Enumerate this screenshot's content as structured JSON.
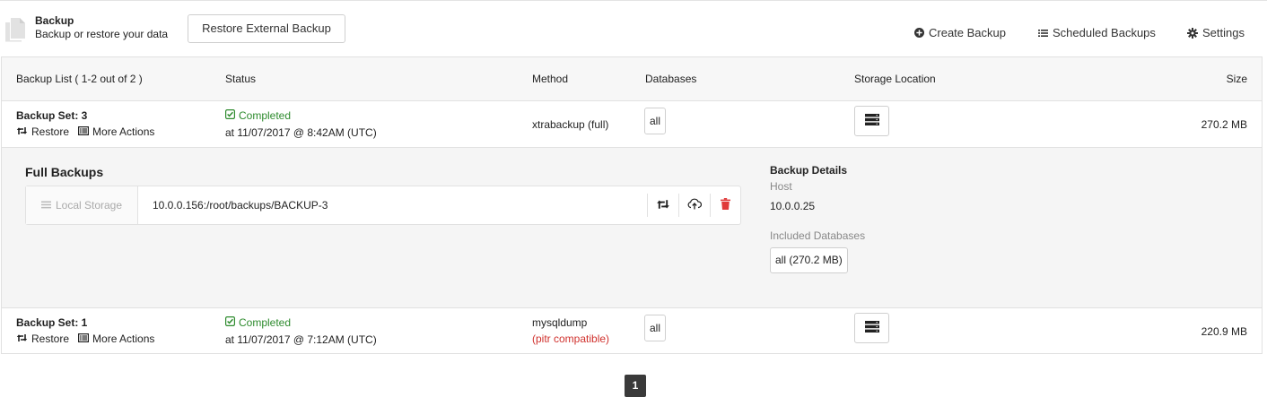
{
  "header": {
    "title": "Backup",
    "subtitle": "Backup or restore your data",
    "restore_external_label": "Restore External Backup",
    "create_backup_label": "Create Backup",
    "scheduled_backups_label": "Scheduled Backups",
    "settings_label": "Settings"
  },
  "table": {
    "columns": {
      "list": "Backup List ( 1-2 out of 2 )",
      "status": "Status",
      "method": "Method",
      "databases": "Databases",
      "storage": "Storage Location",
      "size": "Size"
    },
    "rows": [
      {
        "name": "Backup Set: 3",
        "restore_label": "Restore",
        "more_actions_label": "More Actions",
        "status": "Completed",
        "time": "at 11/07/2017 @ 8:42AM (UTC)",
        "method": "xtrabackup (full)",
        "method_note": "",
        "databases": "all",
        "size": "270.2 MB"
      },
      {
        "name": "Backup Set: 1",
        "restore_label": "Restore",
        "more_actions_label": "More Actions",
        "status": "Completed",
        "time": "at 11/07/2017 @ 7:12AM (UTC)",
        "method": "mysqldump",
        "method_note": "(pitr compatible)",
        "databases": "all",
        "size": "220.9 MB"
      }
    ]
  },
  "detail": {
    "full_backups_title": "Full Backups",
    "local_storage_label": "Local Storage",
    "path": "10.0.0.156:/root/backups/BACKUP-3",
    "details_title": "Backup Details",
    "host_label": "Host",
    "host_value": "10.0.0.25",
    "included_label": "Included Databases",
    "included_value": "all (270.2 MB)"
  },
  "pagination": {
    "current_page": "1"
  },
  "colors": {
    "status_green": "#2e8b2e",
    "note_red": "#d0312d",
    "delete_red": "#e03b3b",
    "page_active": "#3a3a3a"
  },
  "icons": {
    "header": "document-icon",
    "create": "plus-circle-icon",
    "scheduled": "list-icon",
    "settings": "gear-icon",
    "restore": "retweet-icon",
    "more_actions": "list-alt-icon",
    "status": "check-square-icon",
    "storage": "server-icon",
    "upload": "cloud-upload-icon",
    "delete": "trash-icon"
  }
}
